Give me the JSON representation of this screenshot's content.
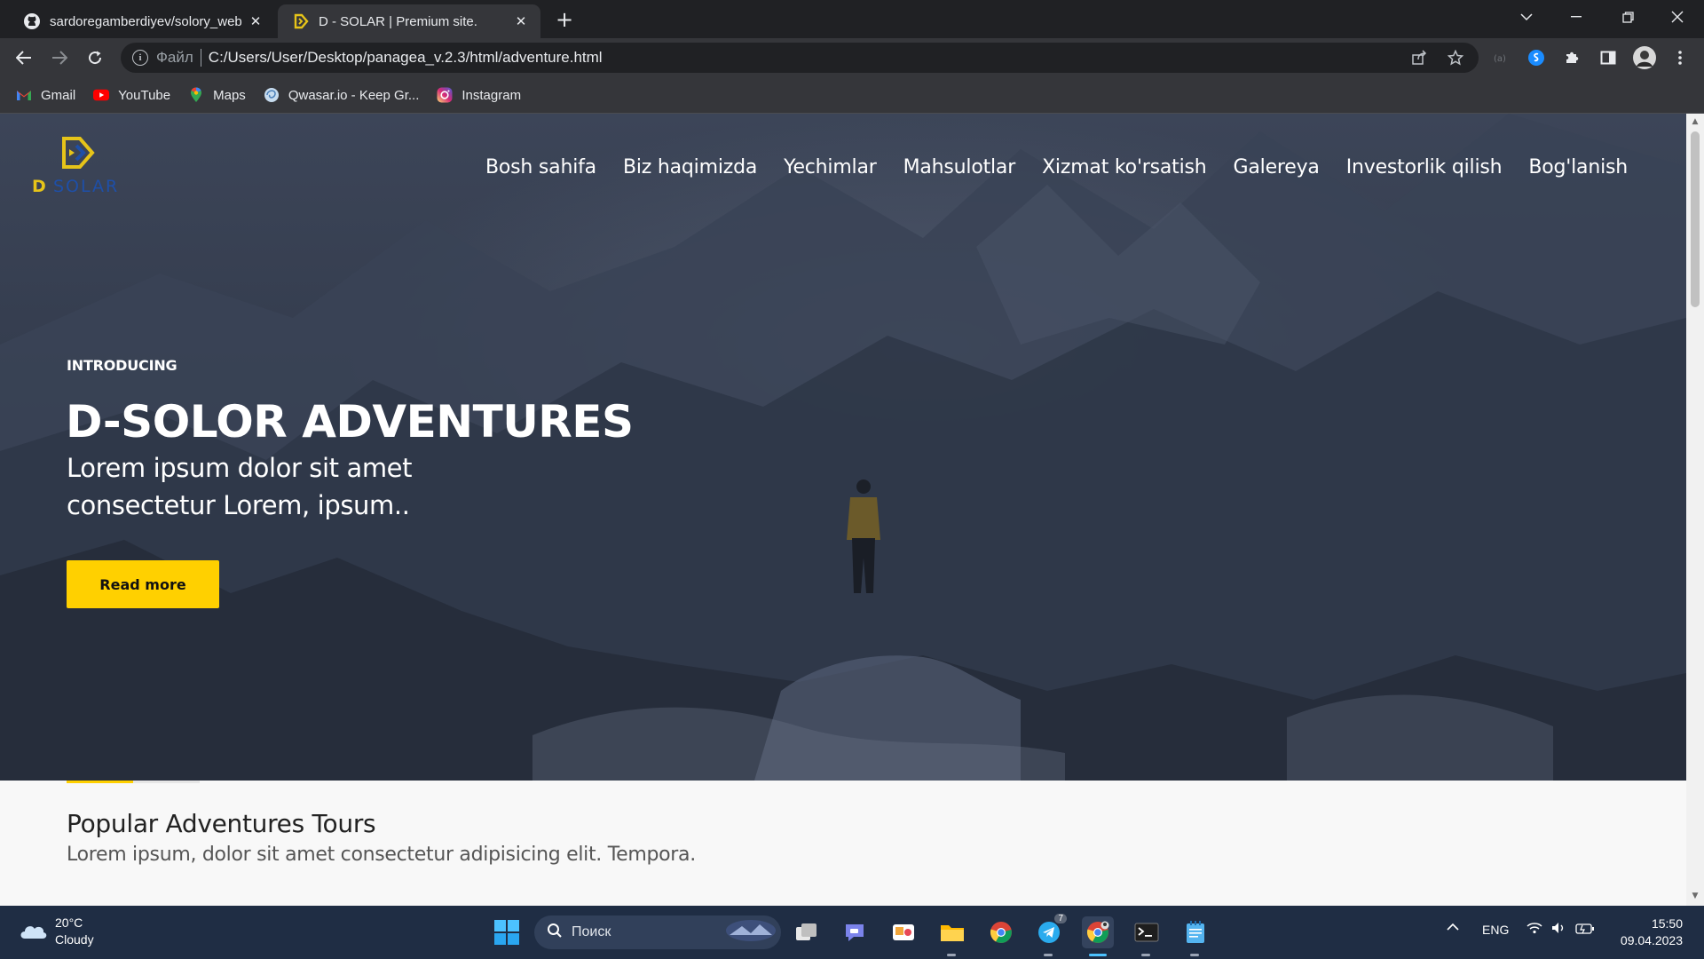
{
  "browser": {
    "tabs": [
      {
        "title": "sardoregamberdiyev/solory_web",
        "active": false
      },
      {
        "title": "D - SOLAR | Premium site.",
        "active": true
      }
    ],
    "new_tab_symbol": "+",
    "address": {
      "scheme_label": "Файл",
      "url": "C:/Users/User/Desktop/panagea_v.2.3/html/adventure.html"
    },
    "bookmarks": [
      {
        "label": "Gmail",
        "icon": "gmail-icon"
      },
      {
        "label": "YouTube",
        "icon": "youtube-icon"
      },
      {
        "label": "Maps",
        "icon": "maps-icon"
      },
      {
        "label": "Qwasar.io - Keep Gr...",
        "icon": "qwasar-icon"
      },
      {
        "label": "Instagram",
        "icon": "instagram-icon"
      }
    ]
  },
  "site": {
    "logo_text": "D SOLAR",
    "nav": [
      "Bosh sahifa",
      "Biz haqimizda",
      "Yechimlar",
      "Mahsulotlar",
      "Xizmat ko'rsatish",
      "Galereya",
      "Investorlik qilish",
      "Bog'lanish"
    ],
    "hero": {
      "eyebrow": "INTRODUCING",
      "title": "D-SOLOR ADVENTURES",
      "subtitle": "Lorem ipsum dolor sit amet consectetur Lorem, ipsum..",
      "button": "Read more"
    },
    "section": {
      "title": "Popular Adventures Tours",
      "text": "Lorem ipsum, dolor sit amet consectetur adipisicing elit. Tempora."
    },
    "colors": {
      "accent": "#ffd000",
      "logo_blue": "#1e4fa8"
    }
  },
  "taskbar": {
    "weather": {
      "temp": "20°C",
      "condition": "Cloudy"
    },
    "search_placeholder": "Поиск",
    "telegram_badge": "7",
    "language": "ENG",
    "time": "15:50",
    "date": "09.04.2023"
  }
}
